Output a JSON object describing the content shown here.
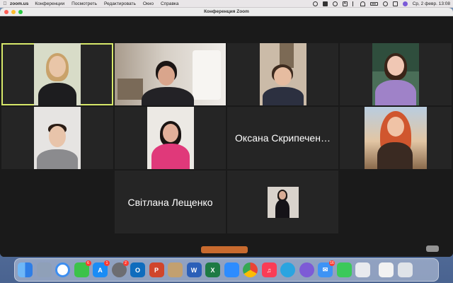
{
  "menubar": {
    "app_name": "zoom.us",
    "menus": [
      "Конференции",
      "Посмотреть",
      "Редактировать",
      "Окно",
      "Справка"
    ],
    "input_lang": "A",
    "datetime": "Ср, 2 февр. 13:08"
  },
  "window": {
    "title": "Конференция Zoom"
  },
  "participants": {
    "oksana_name": "Оксана Скрипечен…",
    "svitlana_name": "Світлана Лещенко"
  },
  "dock": {
    "badges": {
      "facetime": "6",
      "appstore": "1",
      "settings": "2",
      "mail": "16"
    },
    "icons": [
      "finder-icon",
      "launchpad-icon",
      "safari-icon",
      "facetime-icon",
      "appstore-icon",
      "system-preferences-icon",
      "outlook-icon",
      "powerpoint-icon",
      "archive-icon",
      "word-icon",
      "excel-icon",
      "zoom-icon",
      "chrome-icon",
      "music-icon",
      "telegram-icon",
      "viber-icon",
      "mail-icon",
      "messages-icon",
      "preview-icon",
      "notes-icon",
      "trash-icon"
    ]
  }
}
